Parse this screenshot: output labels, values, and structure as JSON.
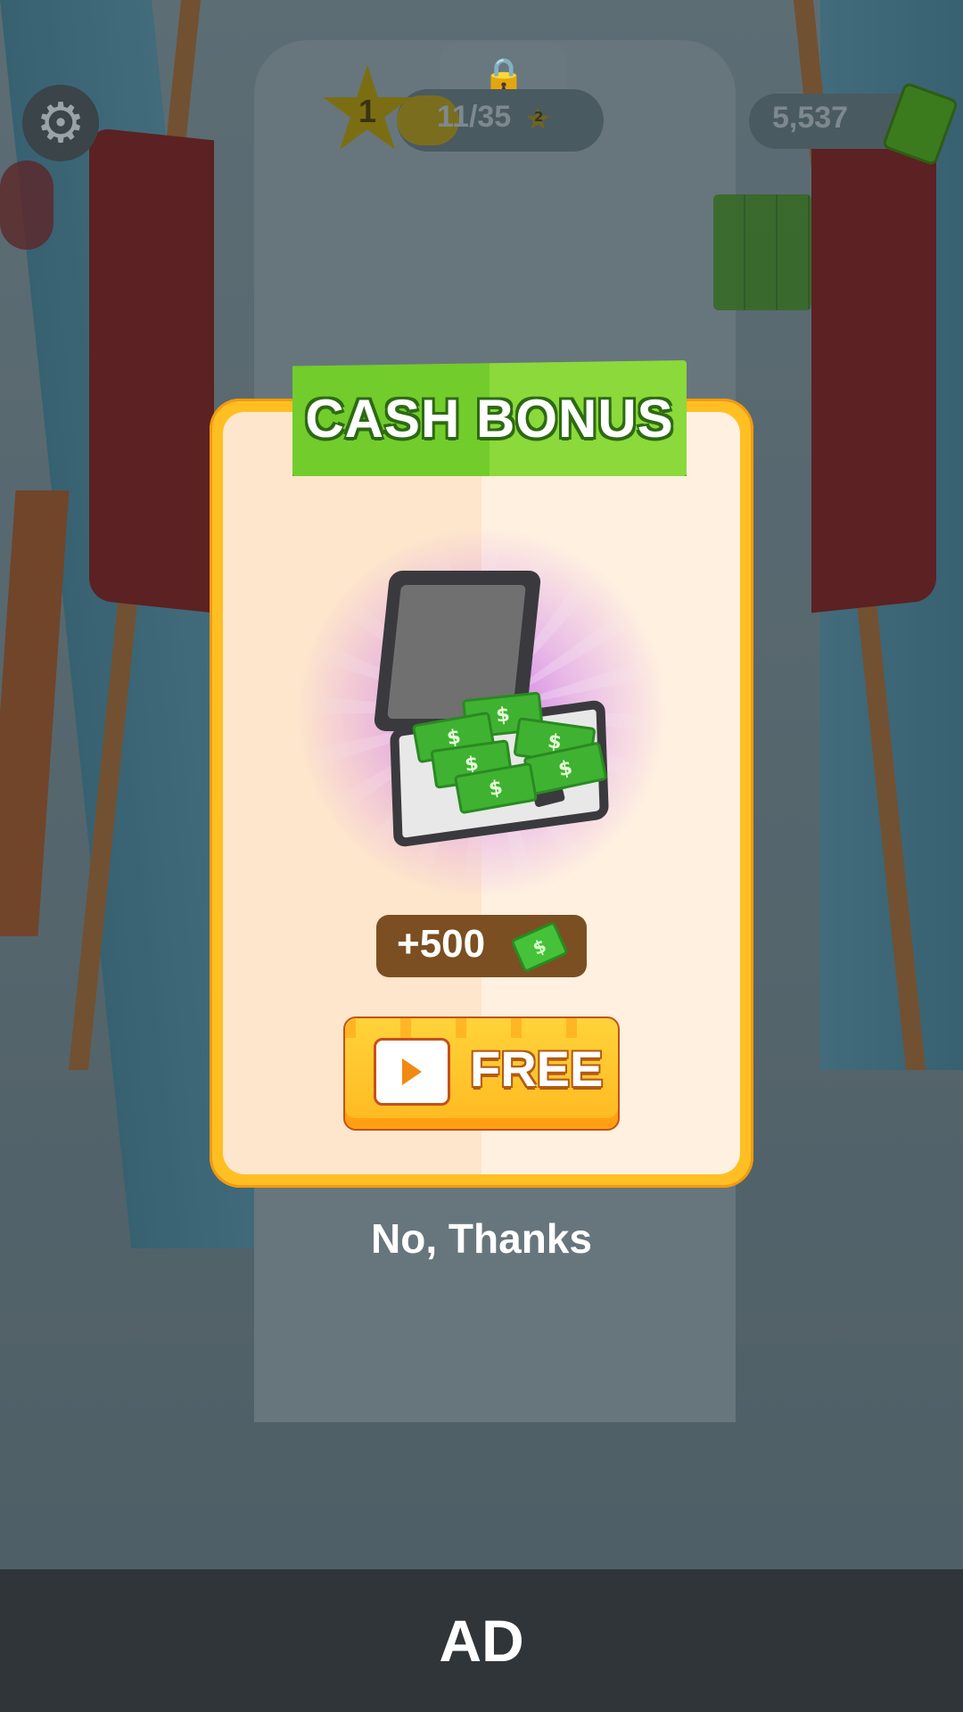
{
  "hud": {
    "level": "1",
    "level_progress": "11/35",
    "mini_star_number": "2",
    "cash": "5,537"
  },
  "dialog": {
    "title": "CASH BONUS",
    "reward_amount": "+500",
    "free_button_label": "FREE",
    "decline_label": "No, Thanks",
    "bill_symbol": "$"
  },
  "ad": {
    "label": "AD"
  },
  "colors": {
    "banner_green": "#72cc2c",
    "card_border": "#ffbf22",
    "button_orange": "#ffb820",
    "reward_pill": "#7b4f22",
    "ad_bar": "#2f3538"
  },
  "icons": {
    "settings": "gear-icon",
    "level": "star-icon",
    "locked": "lock-icon",
    "cash": "cash-icon",
    "play": "play-icon",
    "prize": "briefcase-icon"
  }
}
